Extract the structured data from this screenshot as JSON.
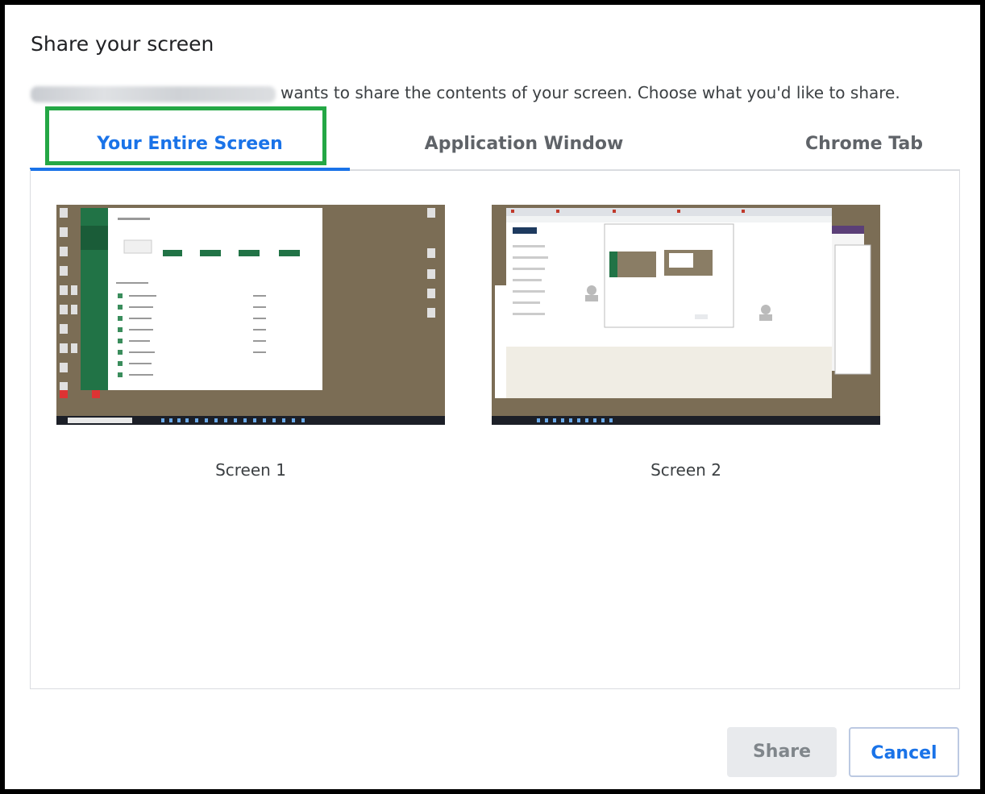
{
  "dialog": {
    "title": "Share your screen",
    "message": "wants to share the contents of your screen. Choose what you'd like to share."
  },
  "tabs": [
    {
      "label": "Your Entire Screen",
      "active": true
    },
    {
      "label": "Application Window",
      "active": false
    },
    {
      "label": "Chrome Tab",
      "active": false
    }
  ],
  "sources": [
    {
      "label": "Screen 1"
    },
    {
      "label": "Screen 2"
    }
  ],
  "buttons": {
    "share": "Share",
    "cancel": "Cancel"
  },
  "colors": {
    "accent": "#1a73e8",
    "highlight_box": "#24a745",
    "desktop_wallpaper": "#7b6d55"
  }
}
